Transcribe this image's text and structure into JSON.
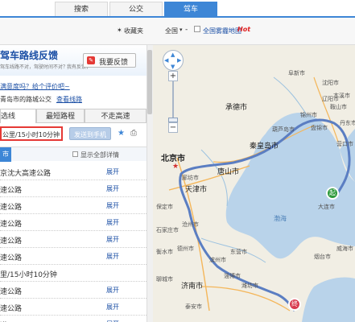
{
  "tabs": [
    "搜索",
    "公交",
    "驾车"
  ],
  "active_tab": "驾车",
  "toolbar": {
    "favorites": "收藏夹",
    "region": "全国",
    "region_sep": "-",
    "satellite": "全国雾霾地图",
    "hot": "Hot"
  },
  "panel": {
    "title": "驾车路线反馈",
    "subtitle": "驾车线路不对，驾驶时间不对？",
    "subtitle_tail": "我有反馈，",
    "feedback_button": "我要反馈",
    "satisfaction": "满意度吗？给个评价吧~",
    "bus_hint_prefix": "青岛市的路城公交",
    "bus_hint_link": "查看线路",
    "route_tabs": [
      "选线",
      "最短路程",
      "不走高速"
    ],
    "summary": "公里/15小时10分钟",
    "send_phone": "发送到手机",
    "city_label": "市",
    "show_all": "显示全部详情",
    "routes": [
      {
        "name": "京沈大高速公路",
        "action": "展开"
      },
      {
        "name": "速公路",
        "action": "展开"
      },
      {
        "name": "速公路",
        "action": "展开"
      },
      {
        "name": "速公路",
        "action": "展开"
      },
      {
        "name": "速公路",
        "action": "展开"
      },
      {
        "name": "速公路",
        "action": "展开"
      },
      {
        "name": "里/15小时10分钟",
        "action": ""
      },
      {
        "name": "速公路",
        "action": "展开"
      },
      {
        "name": "速公路",
        "action": "展开"
      },
      {
        "name": "道",
        "action": "展开"
      }
    ]
  },
  "map": {
    "cities": [
      "北京市",
      "天津市",
      "唐山市",
      "秦皇岛市",
      "承德市",
      "锦州市",
      "营口市",
      "济南市",
      "潍坊市",
      "烟台市",
      "威海市",
      "沧州市",
      "德州市",
      "石家庄市",
      "沈阳市",
      "大连市"
    ],
    "small": [
      "鞍山市",
      "葫芦岛市",
      "本溪市",
      "廊坊市",
      "保定市",
      "滨州市",
      "东营市",
      "淄博市",
      "泰安市",
      "聊城市",
      "衡水市",
      "辽阳市",
      "丹东市",
      "阜新市",
      "盘锦市"
    ],
    "water": "渤海",
    "start_marker": "起",
    "end_marker": "终",
    "zoom_levels": [
      "+",
      "−"
    ]
  },
  "colors": {
    "accent": "#3d86d6",
    "route": "#5b7ec2",
    "hot": "#e02020",
    "highlight_box": "#e53935",
    "start": "#2e9a3c",
    "end": "#d83a4e"
  }
}
